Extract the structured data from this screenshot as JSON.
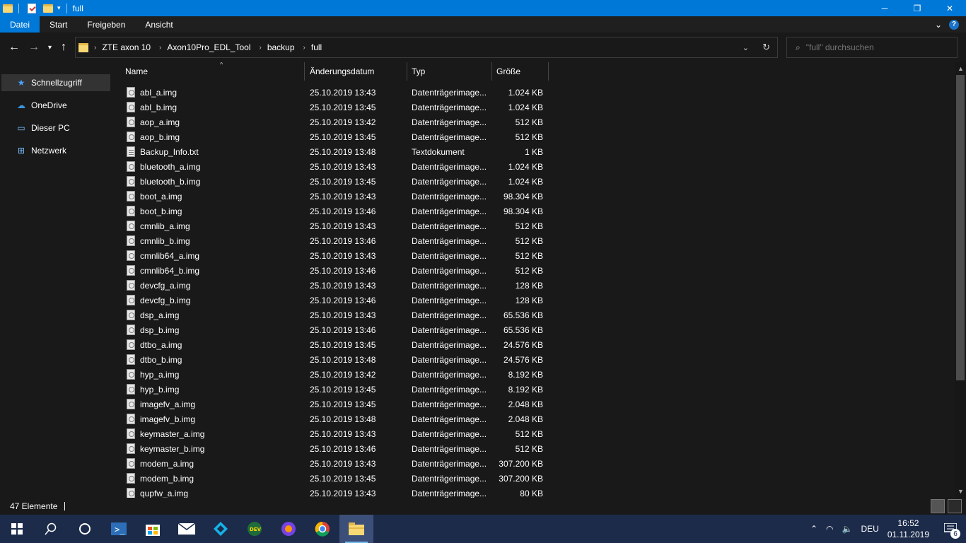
{
  "window": {
    "title": "full",
    "minimize": "─",
    "maximize": "❐",
    "close": "✕"
  },
  "ribbon": {
    "tabs": [
      "Datei",
      "Start",
      "Freigeben",
      "Ansicht"
    ]
  },
  "address": {
    "breadcrumbs": [
      "ZTE axon 10",
      "Axon10Pro_EDL_Tool",
      "backup",
      "full"
    ],
    "search_placeholder": "\"full\" durchsuchen"
  },
  "sidebar": {
    "items": [
      {
        "label": "Schnellzugriff",
        "icon": "star-icon"
      },
      {
        "label": "OneDrive",
        "icon": "cloud-icon"
      },
      {
        "label": "Dieser PC",
        "icon": "computer-icon"
      },
      {
        "label": "Netzwerk",
        "icon": "network-icon"
      }
    ]
  },
  "columns": [
    "Name",
    "Änderungsdatum",
    "Typ",
    "Größe"
  ],
  "files": [
    {
      "name": "abl_a.img",
      "date": "25.10.2019 13:43",
      "type": "Datenträgerimage...",
      "size": "1.024 KB"
    },
    {
      "name": "abl_b.img",
      "date": "25.10.2019 13:45",
      "type": "Datenträgerimage...",
      "size": "1.024 KB"
    },
    {
      "name": "aop_a.img",
      "date": "25.10.2019 13:42",
      "type": "Datenträgerimage...",
      "size": "512 KB"
    },
    {
      "name": "aop_b.img",
      "date": "25.10.2019 13:45",
      "type": "Datenträgerimage...",
      "size": "512 KB"
    },
    {
      "name": "Backup_Info.txt",
      "date": "25.10.2019 13:48",
      "type": "Textdokument",
      "size": "1 KB"
    },
    {
      "name": "bluetooth_a.img",
      "date": "25.10.2019 13:43",
      "type": "Datenträgerimage...",
      "size": "1.024 KB"
    },
    {
      "name": "bluetooth_b.img",
      "date": "25.10.2019 13:45",
      "type": "Datenträgerimage...",
      "size": "1.024 KB"
    },
    {
      "name": "boot_a.img",
      "date": "25.10.2019 13:43",
      "type": "Datenträgerimage...",
      "size": "98.304 KB"
    },
    {
      "name": "boot_b.img",
      "date": "25.10.2019 13:46",
      "type": "Datenträgerimage...",
      "size": "98.304 KB"
    },
    {
      "name": "cmnlib_a.img",
      "date": "25.10.2019 13:43",
      "type": "Datenträgerimage...",
      "size": "512 KB"
    },
    {
      "name": "cmnlib_b.img",
      "date": "25.10.2019 13:46",
      "type": "Datenträgerimage...",
      "size": "512 KB"
    },
    {
      "name": "cmnlib64_a.img",
      "date": "25.10.2019 13:43",
      "type": "Datenträgerimage...",
      "size": "512 KB"
    },
    {
      "name": "cmnlib64_b.img",
      "date": "25.10.2019 13:46",
      "type": "Datenträgerimage...",
      "size": "512 KB"
    },
    {
      "name": "devcfg_a.img",
      "date": "25.10.2019 13:43",
      "type": "Datenträgerimage...",
      "size": "128 KB"
    },
    {
      "name": "devcfg_b.img",
      "date": "25.10.2019 13:46",
      "type": "Datenträgerimage...",
      "size": "128 KB"
    },
    {
      "name": "dsp_a.img",
      "date": "25.10.2019 13:43",
      "type": "Datenträgerimage...",
      "size": "65.536 KB"
    },
    {
      "name": "dsp_b.img",
      "date": "25.10.2019 13:46",
      "type": "Datenträgerimage...",
      "size": "65.536 KB"
    },
    {
      "name": "dtbo_a.img",
      "date": "25.10.2019 13:45",
      "type": "Datenträgerimage...",
      "size": "24.576 KB"
    },
    {
      "name": "dtbo_b.img",
      "date": "25.10.2019 13:48",
      "type": "Datenträgerimage...",
      "size": "24.576 KB"
    },
    {
      "name": "hyp_a.img",
      "date": "25.10.2019 13:42",
      "type": "Datenträgerimage...",
      "size": "8.192 KB"
    },
    {
      "name": "hyp_b.img",
      "date": "25.10.2019 13:45",
      "type": "Datenträgerimage...",
      "size": "8.192 KB"
    },
    {
      "name": "imagefv_a.img",
      "date": "25.10.2019 13:45",
      "type": "Datenträgerimage...",
      "size": "2.048 KB"
    },
    {
      "name": "imagefv_b.img",
      "date": "25.10.2019 13:48",
      "type": "Datenträgerimage...",
      "size": "2.048 KB"
    },
    {
      "name": "keymaster_a.img",
      "date": "25.10.2019 13:43",
      "type": "Datenträgerimage...",
      "size": "512 KB"
    },
    {
      "name": "keymaster_b.img",
      "date": "25.10.2019 13:46",
      "type": "Datenträgerimage...",
      "size": "512 KB"
    },
    {
      "name": "modem_a.img",
      "date": "25.10.2019 13:43",
      "type": "Datenträgerimage...",
      "size": "307.200 KB"
    },
    {
      "name": "modem_b.img",
      "date": "25.10.2019 13:45",
      "type": "Datenträgerimage...",
      "size": "307.200 KB"
    },
    {
      "name": "qupfw_a.img",
      "date": "25.10.2019 13:43",
      "type": "Datenträgerimage...",
      "size": "80 KB"
    }
  ],
  "status": {
    "count": "47 Elemente"
  },
  "taskbar": {
    "language": "DEU",
    "time": "16:52",
    "date": "01.11.2019",
    "notifications": "6"
  },
  "colors": {
    "accent": "#0078d7",
    "background": "#191919",
    "taskbar": "#1c2b4a"
  }
}
